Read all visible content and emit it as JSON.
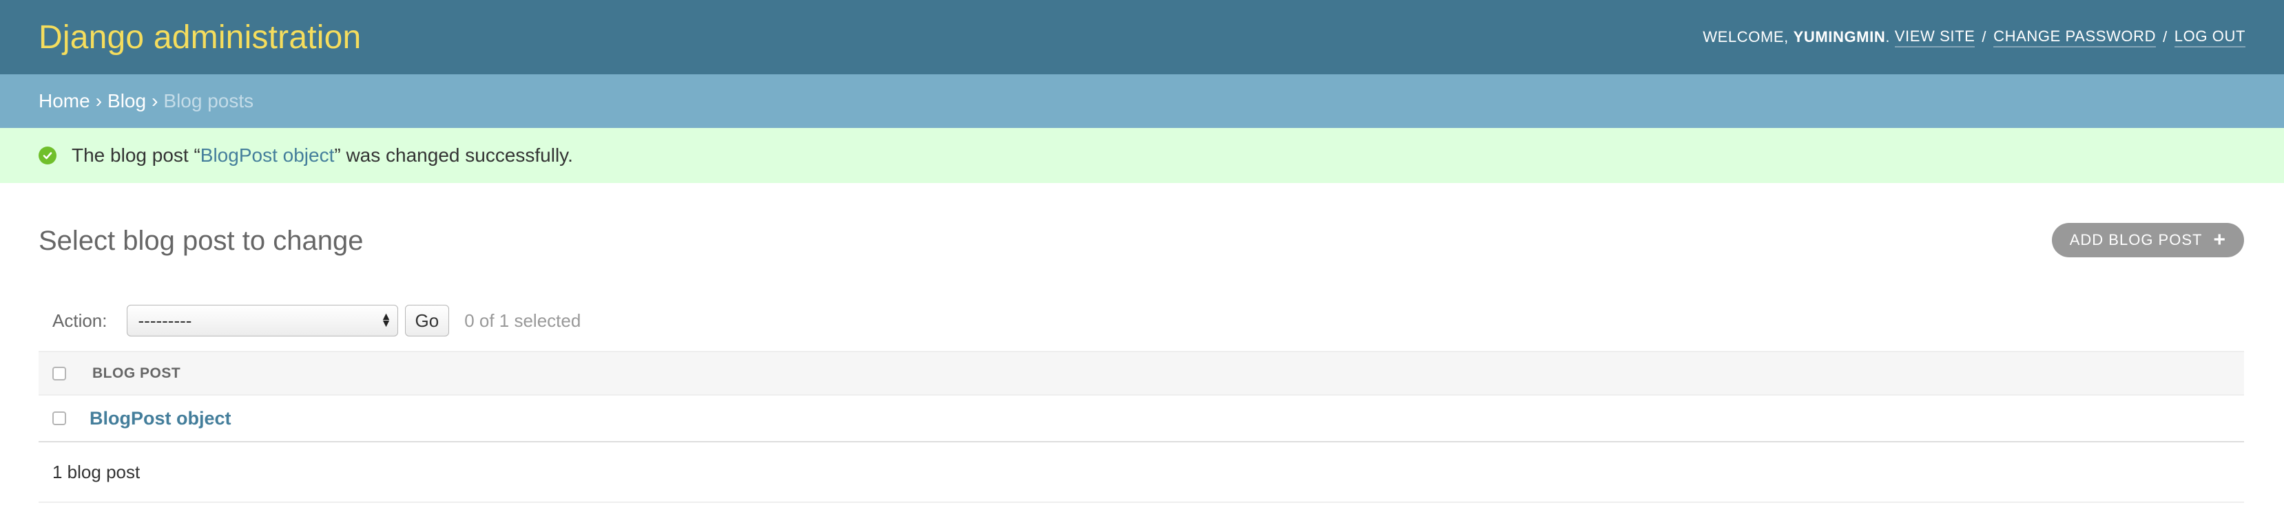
{
  "header": {
    "site_name": "Django administration",
    "welcome": "Welcome,",
    "username": "yumingmin",
    "view_site": "View site",
    "change_password": "Change password",
    "log_out": "Log out",
    "separator": "/",
    "colors": {
      "header_bg": "#417690",
      "site_name": "#f5dd5d"
    }
  },
  "breadcrumbs": {
    "home": "Home",
    "app": "Blog",
    "current": "Blog posts",
    "arrow": "›"
  },
  "message": {
    "prefix": "The blog post “",
    "link_text": "BlogPost object",
    "suffix": "” was changed successfully.",
    "icon": "check-circle-icon"
  },
  "content": {
    "title": "Select blog post to change",
    "add_button": "Add blog post",
    "add_icon": "+"
  },
  "actions": {
    "label": "Action:",
    "selected_value": "---------",
    "go_label": "Go",
    "selected_count": "0 of 1 selected"
  },
  "table": {
    "column_header": "Blog post",
    "rows": [
      {
        "label": "BlogPost object"
      }
    ]
  },
  "paginator": {
    "count_text": "1 blog post"
  }
}
